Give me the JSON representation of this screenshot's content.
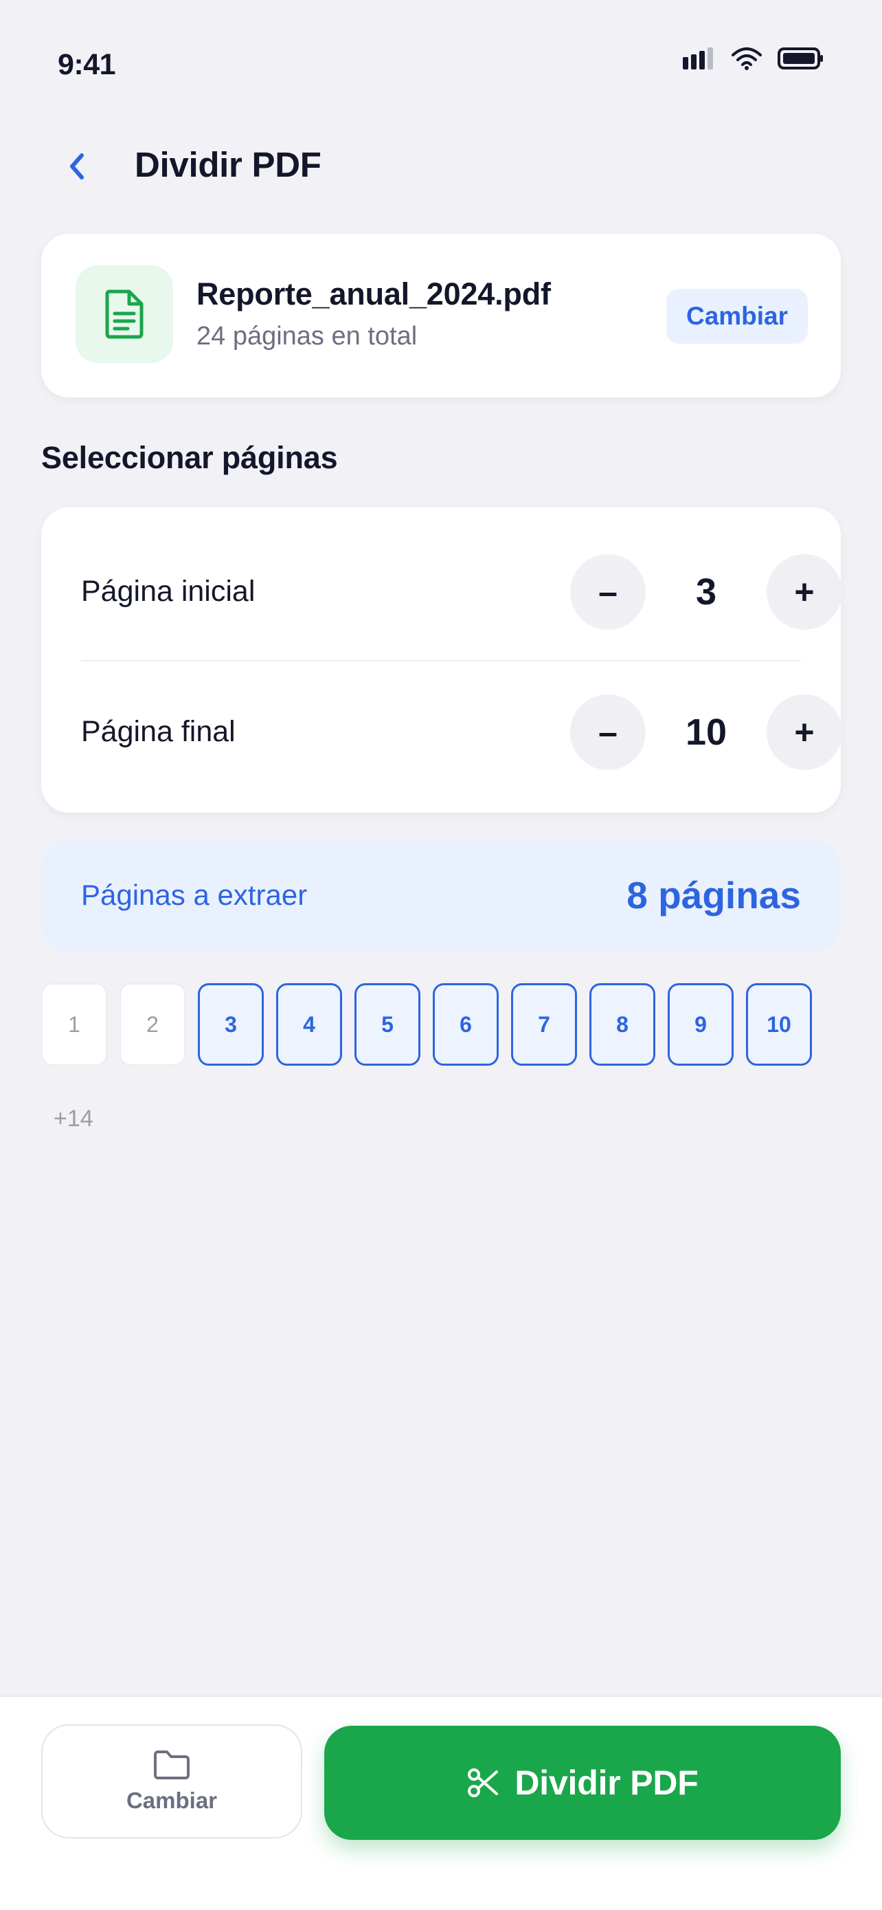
{
  "status_bar": {
    "time": "9:41"
  },
  "header": {
    "title": "Dividir PDF"
  },
  "file": {
    "name": "Reporte_anual_2024.pdf",
    "pages_text": "24 páginas en total",
    "change_label": "Cambiar"
  },
  "section": {
    "title": "Seleccionar páginas"
  },
  "range": {
    "start_label": "Página inicial",
    "start_value": "3",
    "end_label": "Página final",
    "end_value": "10",
    "minus_symbol": "–",
    "plus_symbol": "+"
  },
  "summary": {
    "label": "Páginas a extraer",
    "value": "8 páginas"
  },
  "thumbnails": {
    "pages": [
      "1",
      "2",
      "3",
      "4",
      "5",
      "6",
      "7",
      "8",
      "9",
      "10"
    ],
    "selected": [
      false,
      false,
      true,
      true,
      true,
      true,
      true,
      true,
      true,
      true
    ],
    "more_label": "+14"
  },
  "bottom_bar": {
    "secondary_label": "Cambiar",
    "primary_label": "Dividir PDF"
  },
  "colors": {
    "accent_blue": "#2d65e0",
    "primary_green": "#1aa64a",
    "background": "#f1f1f6"
  },
  "icons": {
    "back": "chevron-left-icon",
    "file": "document-icon",
    "folder": "folder-icon",
    "scissors": "scissors-icon"
  }
}
